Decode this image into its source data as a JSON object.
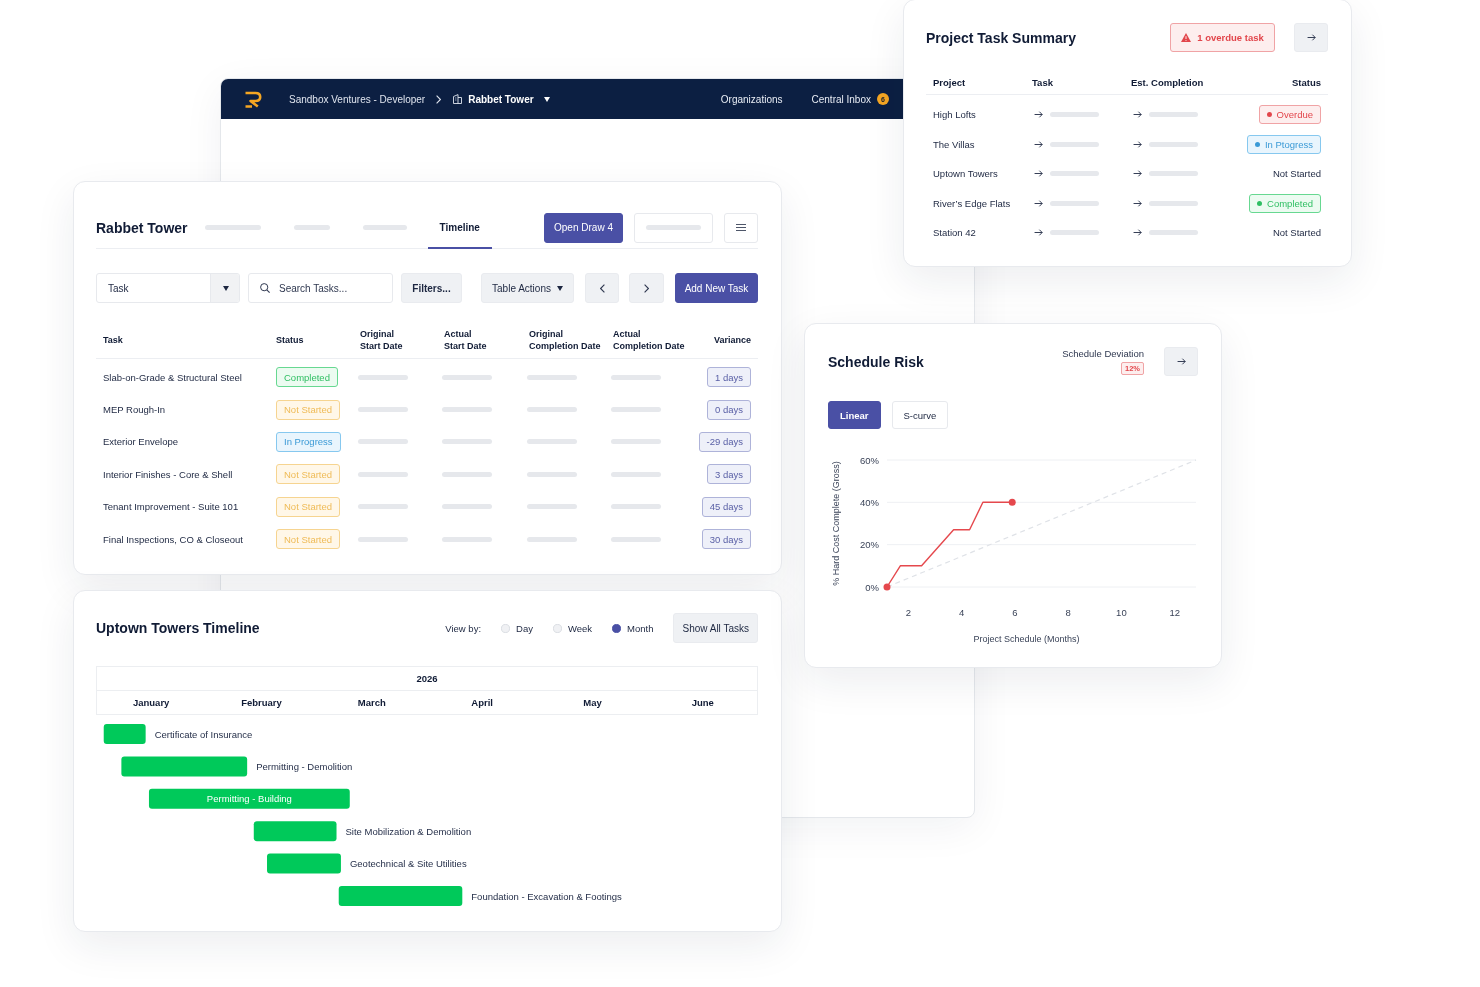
{
  "summary": {
    "title": "Project Task Summary",
    "alert": "1 overdue task",
    "columns": [
      "Project",
      "Task",
      "Est. Completion",
      "Status"
    ],
    "rows": [
      {
        "project": "High Lofts",
        "status": {
          "kind": "overdue",
          "label": "Overdue"
        }
      },
      {
        "project": "The Villas",
        "status": {
          "kind": "in_progress",
          "label": "In Ptogress"
        }
      },
      {
        "project": "Uptown Towers",
        "status": {
          "kind": "plain",
          "label": "Not Started"
        }
      },
      {
        "project": "River’s Edge Flats",
        "status": {
          "kind": "completed",
          "label": "Completed"
        }
      },
      {
        "project": "Station 42",
        "status": {
          "kind": "plain",
          "label": "Not Started"
        }
      }
    ]
  },
  "nav": {
    "breadcrumb": "Sandbox Ventures - Developer",
    "project": "Rabbet Tower",
    "links": [
      {
        "label": "Organizations"
      },
      {
        "label": "Central Inbox",
        "badge": "6"
      }
    ]
  },
  "tasks": {
    "title": "Rabbet Tower",
    "tabs": [
      {
        "kind": "skeleton",
        "selected": false
      },
      {
        "kind": "skeleton",
        "selected": false
      },
      {
        "kind": "skeleton",
        "selected": false
      },
      {
        "kind": "text",
        "label": "Timeline",
        "selected": true
      }
    ],
    "primary_action": "Open Draw 4",
    "toolbar": {
      "task_select": {
        "value": "Task"
      },
      "search": {
        "placeholder": "Search Tasks..."
      },
      "filters": "Filters...",
      "table_actions": "Table Actions",
      "add": "Add New Task"
    },
    "columns": [
      "Task",
      "Status",
      "Original\nStart Date",
      "Actual\nStart Date",
      "Original\nCompletion Date",
      "Actual\nCompletion Date",
      "Variance"
    ],
    "rows": [
      {
        "task": "Slab-on-Grade & Structural Steel",
        "status": {
          "kind": "completed",
          "label": "Completed"
        },
        "variance": "1 days"
      },
      {
        "task": "MEP Rough-In",
        "status": {
          "kind": "not_started",
          "label": "Not Started"
        },
        "variance": "0 days"
      },
      {
        "task": "Exterior Envelope",
        "status": {
          "kind": "in_progress",
          "label": "In Progress"
        },
        "variance": "-29 days"
      },
      {
        "task": "Interior Finishes - Core & Shell",
        "status": {
          "kind": "not_started",
          "label": "Not Started"
        },
        "variance": "3 days"
      },
      {
        "task": "Tenant Improvement - Suite 101",
        "status": {
          "kind": "not_started",
          "label": "Not Started"
        },
        "variance": "45 days"
      },
      {
        "task": "Final Inspections, CO & Closeout",
        "status": {
          "kind": "not_started",
          "label": "Not Started"
        },
        "variance": "30 days"
      }
    ]
  },
  "schedule": {
    "title": "Schedule Risk",
    "deviation_label": "Schedule Deviation",
    "deviation": "12%",
    "modes": [
      {
        "label": "Linear",
        "selected": true
      },
      {
        "label": "S-curve",
        "selected": false
      }
    ],
    "chart_data": {
      "type": "line",
      "xlabel": "Project Schedule (Months)",
      "ylabel": "% Hard Cost Complete (Gross)",
      "x": [
        1.2,
        1.7,
        2.5,
        3.7,
        4.3,
        4.8,
        5.9,
        12.8
      ],
      "series": [
        {
          "line_style": "dashed",
          "color": "#dfe2e7",
          "values": [
            0,
            2.6,
            6.7,
            12.9,
            16,
            18.6,
            24.3,
            60
          ]
        },
        {
          "line_style": "solid",
          "color": "#e5484d",
          "values": [
            0,
            10,
            10,
            27,
            27,
            40,
            40,
            null
          ]
        }
      ],
      "xlim": [
        1.2,
        12.8
      ],
      "ylim": [
        0,
        60
      ],
      "xticks": [
        {
          "value": 2,
          "label": "2"
        },
        {
          "value": 4,
          "label": "4"
        },
        {
          "value": 6,
          "label": "6"
        },
        {
          "value": 8,
          "label": "8"
        },
        {
          "value": 10,
          "label": "10"
        },
        {
          "value": 12,
          "label": "12"
        }
      ],
      "yticks": [
        {
          "value": 0,
          "label": "0%"
        },
        {
          "value": 20,
          "label": "20%"
        },
        {
          "value": 40,
          "label": "40%"
        },
        {
          "value": 60,
          "label": "60%"
        }
      ]
    }
  },
  "timeline": {
    "title": "Uptown Towers Timeline",
    "view_by": "View by:",
    "views": [
      {
        "label": "Day",
        "selected": false
      },
      {
        "label": "Week",
        "selected": false
      },
      {
        "label": "Month",
        "selected": true
      }
    ],
    "button": "Show All Tasks",
    "year": "2026",
    "months": [
      "January",
      "February",
      "March",
      "April",
      "May",
      "June"
    ],
    "tasks": [
      {
        "label": "Certificate of Insurance",
        "label_inside": false
      },
      {
        "label": "Permitting - Demolition",
        "label_inside": false
      },
      {
        "label": "Permitting - Building",
        "label_inside": true
      },
      {
        "label": "Site Mobilization & Demolition",
        "label_inside": false
      },
      {
        "label": "Geotechnical & Site Utilities",
        "label_inside": false
      },
      {
        "label": "Foundation - Excavation & Footings",
        "label_inside": false
      }
    ]
  }
}
